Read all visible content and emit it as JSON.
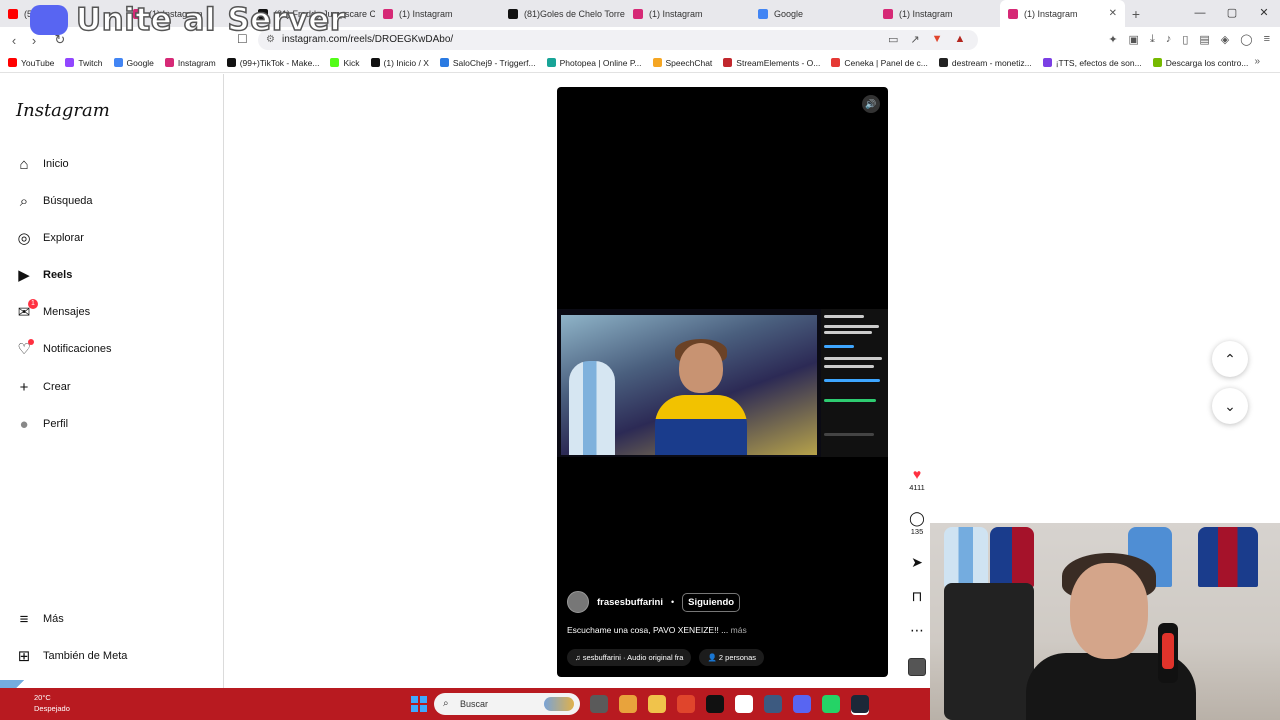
{
  "overlay": {
    "brand_text": "Unite al Server",
    "brand_icon": "discord-icon"
  },
  "tabs": [
    {
      "label": "(5)",
      "color": "#ff0000",
      "active": false
    },
    {
      "label": "(1) Instagram",
      "color": "#d62976",
      "active": false
    },
    {
      "label": "(81) Freddy Jumpscare C",
      "color": "#111111",
      "active": false
    },
    {
      "label": "(1) Instagram",
      "color": "#d62976",
      "active": false
    },
    {
      "label": "(81)Goles de Chelo Torres",
      "color": "#111111",
      "active": false
    },
    {
      "label": "(1) Instagram",
      "color": "#d62976",
      "active": false
    },
    {
      "label": "Google",
      "color": "#4285f4",
      "active": false
    },
    {
      "label": "(1) Instagram",
      "color": "#d62976",
      "active": false
    },
    {
      "label": "(1) Instagram",
      "color": "#d62976",
      "active": true
    }
  ],
  "address": {
    "url": "instagram.com/reels/DROEGKwDAbo/"
  },
  "bookmarks": [
    {
      "label": "YouTube",
      "color": "#ff0000"
    },
    {
      "label": "Twitch",
      "color": "#9146ff"
    },
    {
      "label": "Google",
      "color": "#4285f4"
    },
    {
      "label": "Instagram",
      "color": "#d62976"
    },
    {
      "label": "(99+)TikTok - Make...",
      "color": "#111111"
    },
    {
      "label": "Kick",
      "color": "#53fc18"
    },
    {
      "label": "(1) Inicio / X",
      "color": "#111111"
    },
    {
      "label": "SaloChej9 - Triggerf...",
      "color": "#2a7ae2"
    },
    {
      "label": "Photopea | Online P...",
      "color": "#18a497"
    },
    {
      "label": "SpeechChat",
      "color": "#f5a623"
    },
    {
      "label": "StreamElements - O...",
      "color": "#c1272d"
    },
    {
      "label": "Ceneka | Panel de c...",
      "color": "#e53935"
    },
    {
      "label": "destream - monetiz...",
      "color": "#222222"
    },
    {
      "label": "¡TTS, efectos de son...",
      "color": "#7b3fe4"
    },
    {
      "label": "Descarga los contro...",
      "color": "#76b900"
    }
  ],
  "sidebar": {
    "logo": "Instagram",
    "items": [
      {
        "label": "Inicio",
        "icon": "home-icon",
        "glyph": "⌂",
        "badge": ""
      },
      {
        "label": "Búsqueda",
        "icon": "search-icon",
        "glyph": "⌕",
        "badge": ""
      },
      {
        "label": "Explorar",
        "icon": "compass-icon",
        "glyph": "◎",
        "badge": ""
      },
      {
        "label": "Reels",
        "icon": "reels-icon",
        "glyph": "▶",
        "badge": ""
      },
      {
        "label": "Mensajes",
        "icon": "messenger-icon",
        "glyph": "✉",
        "badge": "1"
      },
      {
        "label": "Notificaciones",
        "icon": "heart-icon",
        "glyph": "♡",
        "badge": "dot"
      },
      {
        "label": "Crear",
        "icon": "plus-icon",
        "glyph": "+",
        "badge": ""
      },
      {
        "label": "Perfil",
        "icon": "profile-avatar",
        "glyph": "●",
        "badge": ""
      }
    ],
    "bottom": [
      {
        "label": "Más",
        "icon": "menu-icon",
        "glyph": "≡"
      },
      {
        "label": "También de Meta",
        "icon": "meta-icon",
        "glyph": "⊞"
      }
    ]
  },
  "reel": {
    "username": "frasesbuffarini",
    "separator": "•",
    "follow_label": "Siguiendo",
    "caption": "Escuchame una cosa, PAVO XENEIZE!! ...",
    "more_label": "más",
    "audio": "♫ sesbuffarini · Audio original  fra",
    "people": "2 personas"
  },
  "actions": {
    "likes": "4111",
    "comments": "135"
  },
  "taskbar": {
    "temperature": "20°C",
    "weather": "Despejado",
    "search_placeholder": "Buscar",
    "apps": [
      "#5a5a5a",
      "#e8a33c",
      "#f0c34b",
      "#e0452c",
      "#111111",
      "#ffffff",
      "#3d5a80",
      "#5865f2",
      "#25d366",
      "#1b2838"
    ]
  }
}
